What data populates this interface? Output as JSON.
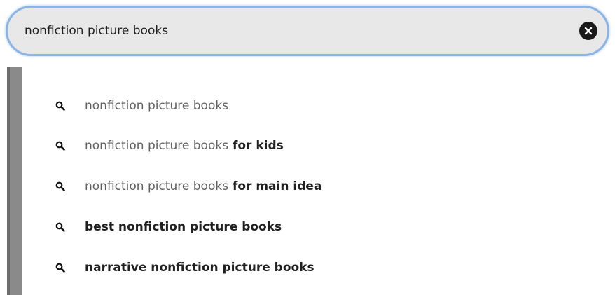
{
  "search": {
    "value": "nonfiction picture books"
  },
  "suggestions": [
    {
      "prefix": "nonfiction picture books",
      "suffix": ""
    },
    {
      "prefix": "nonfiction picture books",
      "suffix": " for kids"
    },
    {
      "prefix": "nonfiction picture books",
      "suffix": " for main idea"
    },
    {
      "prefix": "",
      "suffix": "best nonfiction picture books"
    },
    {
      "prefix": "",
      "suffix": "narrative nonfiction picture books"
    }
  ],
  "icons": {
    "clear": "close-circle-icon",
    "suggestion": "search-icon"
  },
  "colors": {
    "search_border": "#8ab4e4",
    "search_background": "#e8e8e8",
    "scrollbar": "#8a8a8a"
  }
}
